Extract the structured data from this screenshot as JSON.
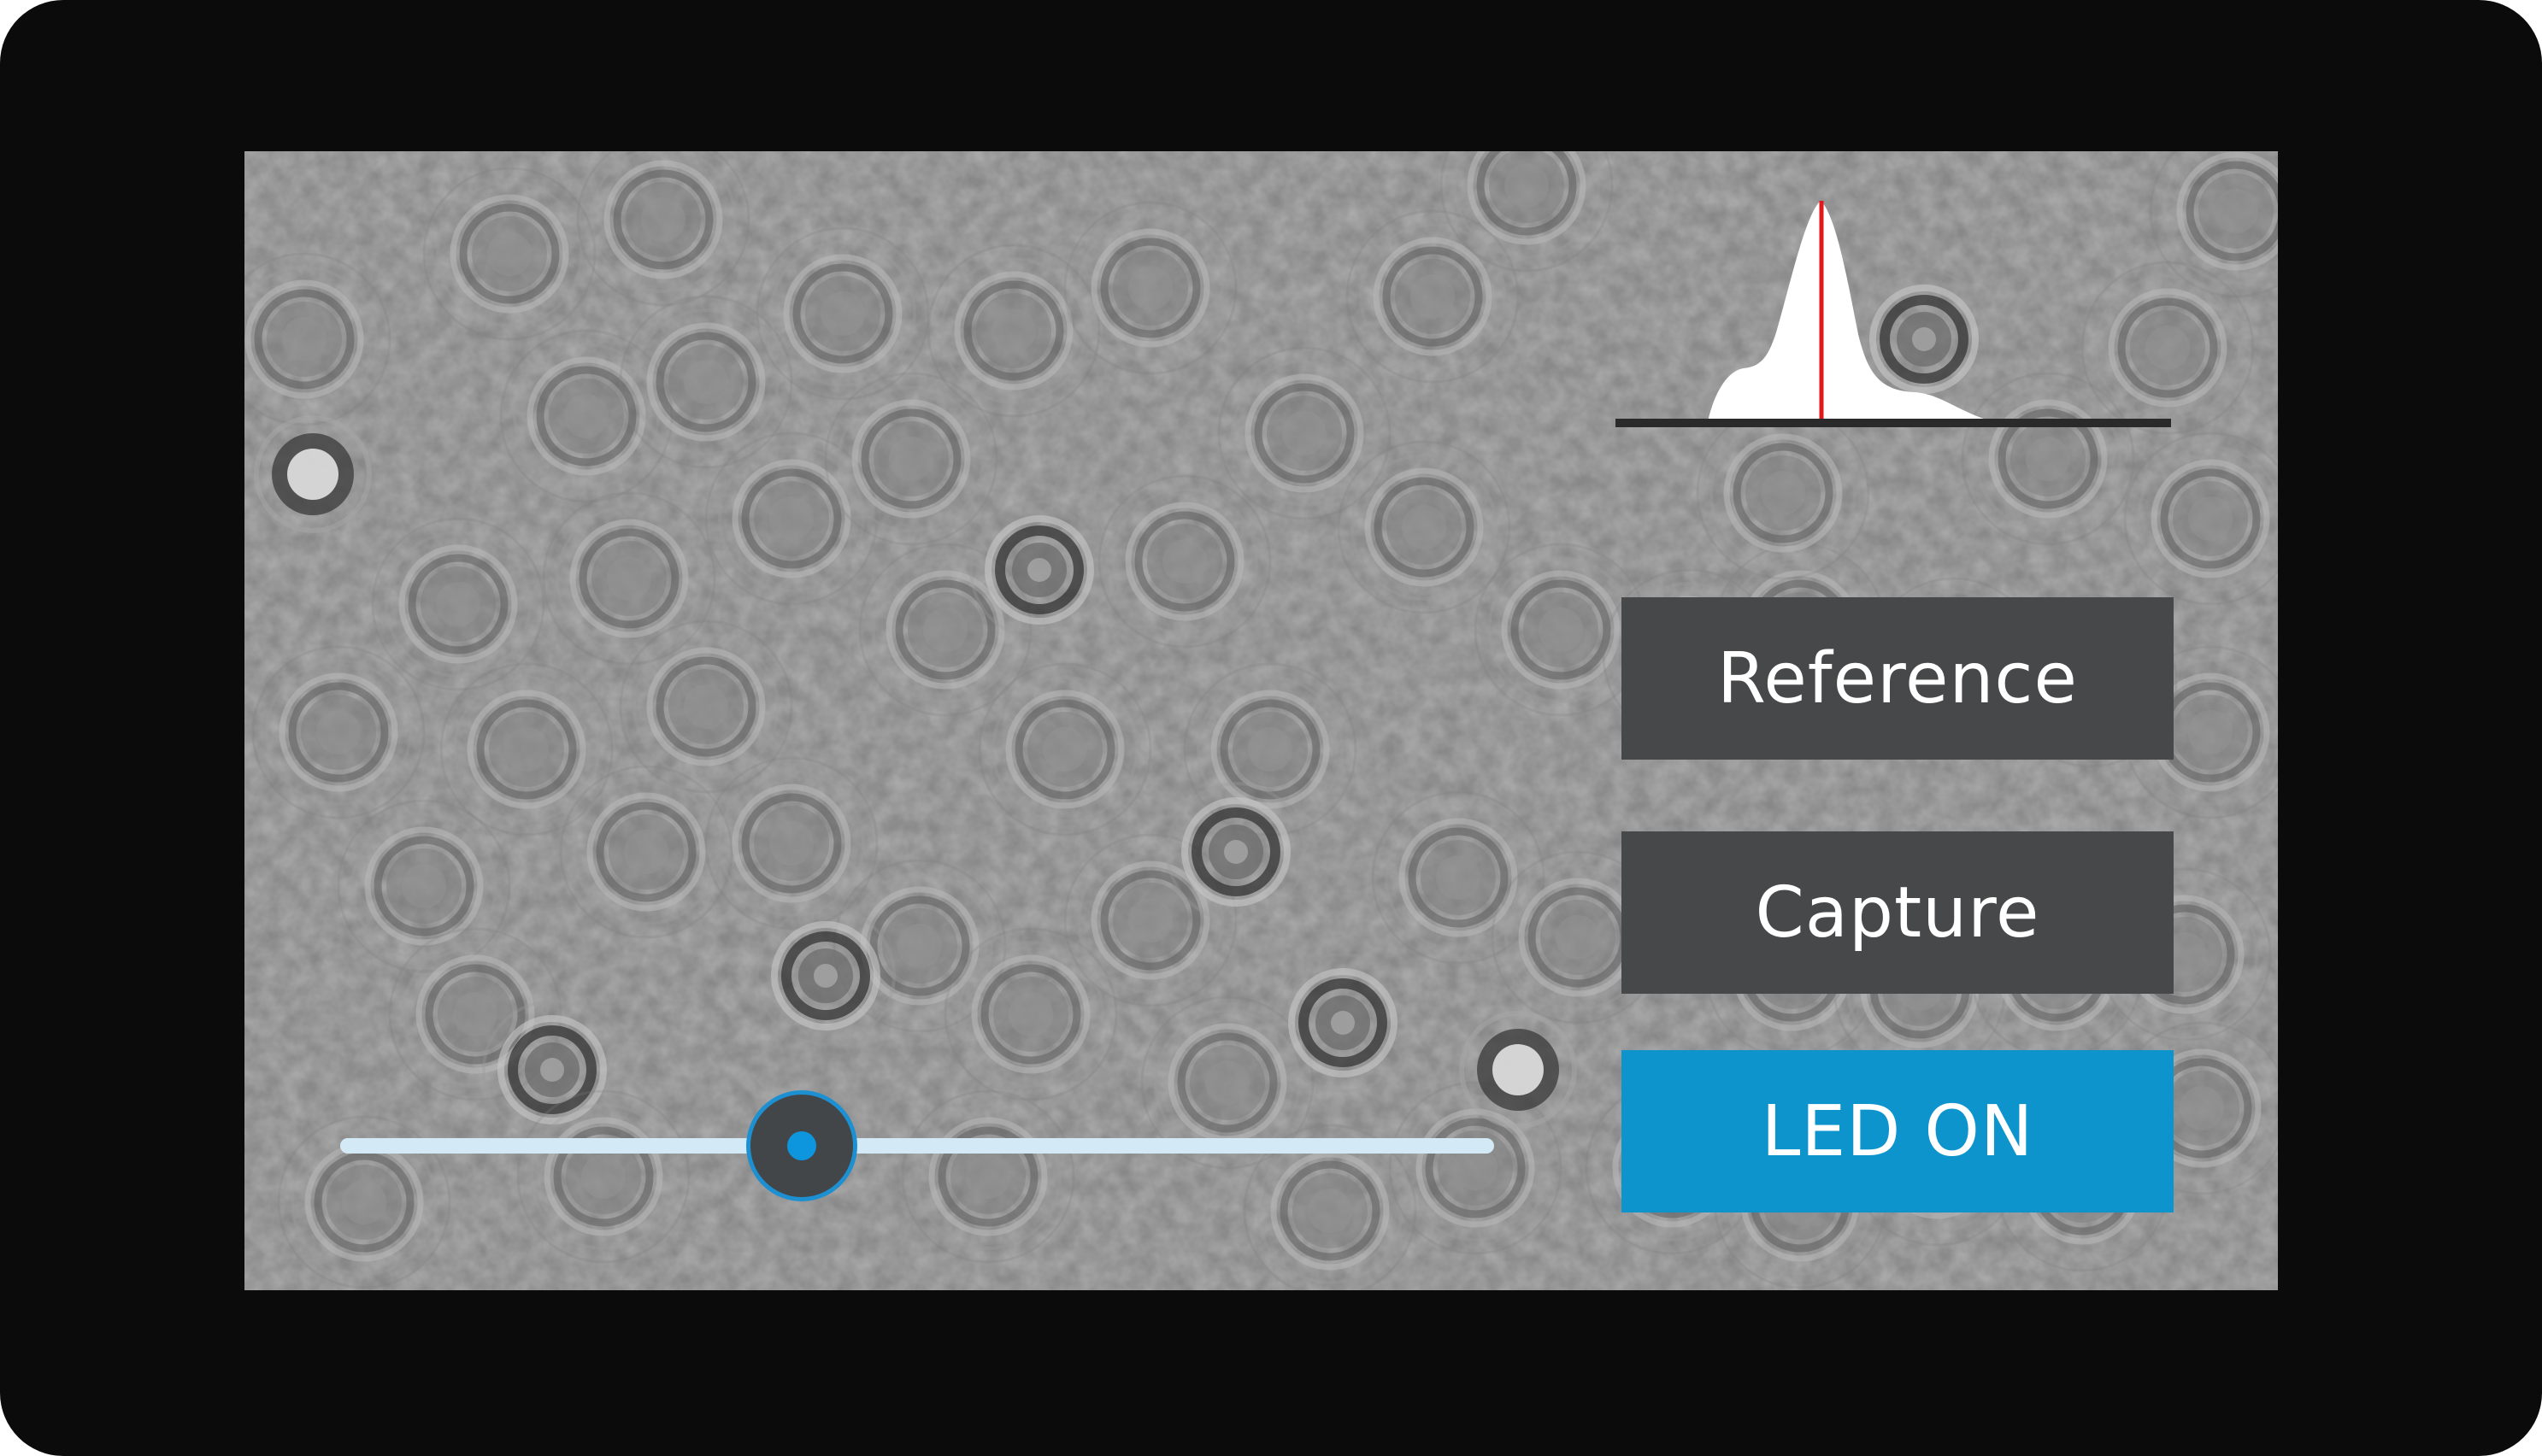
{
  "screen": {
    "image_kind": "brightfield-microscope-view"
  },
  "histogram": {
    "icon": "intensity-histogram-icon",
    "curve_color": "#ffffff",
    "marker_color": "#e0181b",
    "baseline_color": "#2a2a2a"
  },
  "buttons": {
    "reference_label": "Reference",
    "capture_label": "Capture",
    "led_label": "LED ON"
  },
  "slider": {
    "value_fraction": 0.4,
    "track_color": "#d3e9f6",
    "thumb_color": "#434649",
    "accent_color": "#0d96de"
  },
  "colors": {
    "button_dark": "#47484a",
    "button_active": "#0e94cd",
    "bezel": "#0b0b0b"
  }
}
